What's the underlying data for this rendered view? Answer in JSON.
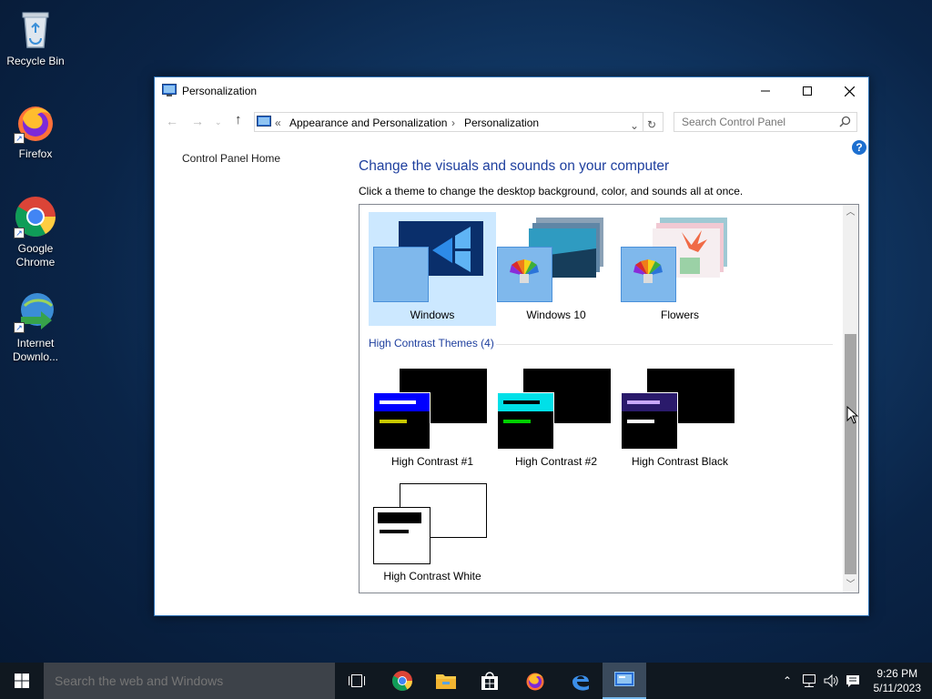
{
  "desktop": {
    "icons": [
      {
        "label": "Recycle Bin",
        "icon": "recycle-bin-icon"
      },
      {
        "label": "Firefox",
        "icon": "firefox-icon"
      },
      {
        "label": "Google Chrome",
        "icon": "chrome-icon"
      },
      {
        "label": "Internet Downlo...",
        "icon": "idm-icon"
      }
    ]
  },
  "window": {
    "title": "Personalization",
    "address": {
      "overflow": "«",
      "crumbs": [
        "Appearance and Personalization",
        "Personalization"
      ]
    },
    "search_placeholder": "Search Control Panel",
    "help": "?",
    "sidebar": {
      "home_link": "Control Panel Home"
    },
    "heading": "Change the visuals and sounds on your computer",
    "subtext": "Click a theme to change the desktop background, color, and sounds all at once.",
    "themes": [
      {
        "label": "Windows",
        "selected": true
      },
      {
        "label": "Windows 10",
        "selected": false
      },
      {
        "label": "Flowers",
        "selected": false
      }
    ],
    "high_contrast_header": "High Contrast Themes (4)",
    "high_contrast_themes": [
      {
        "label": "High Contrast #1"
      },
      {
        "label": "High Contrast #2"
      },
      {
        "label": "High Contrast Black"
      },
      {
        "label": "High Contrast White"
      }
    ]
  },
  "taskbar": {
    "search_placeholder": "Search the web and Windows",
    "apps": [
      "task-view-icon",
      "chrome-icon",
      "file-explorer-icon",
      "store-icon",
      "firefox-icon",
      "edge-icon",
      "control-panel-icon"
    ],
    "clock": {
      "time": "9:26 PM",
      "date": "5/11/2023"
    }
  },
  "colors": {
    "accent": "#1e3f9e",
    "selection": "#cce8ff",
    "taskbar": "#101820"
  }
}
